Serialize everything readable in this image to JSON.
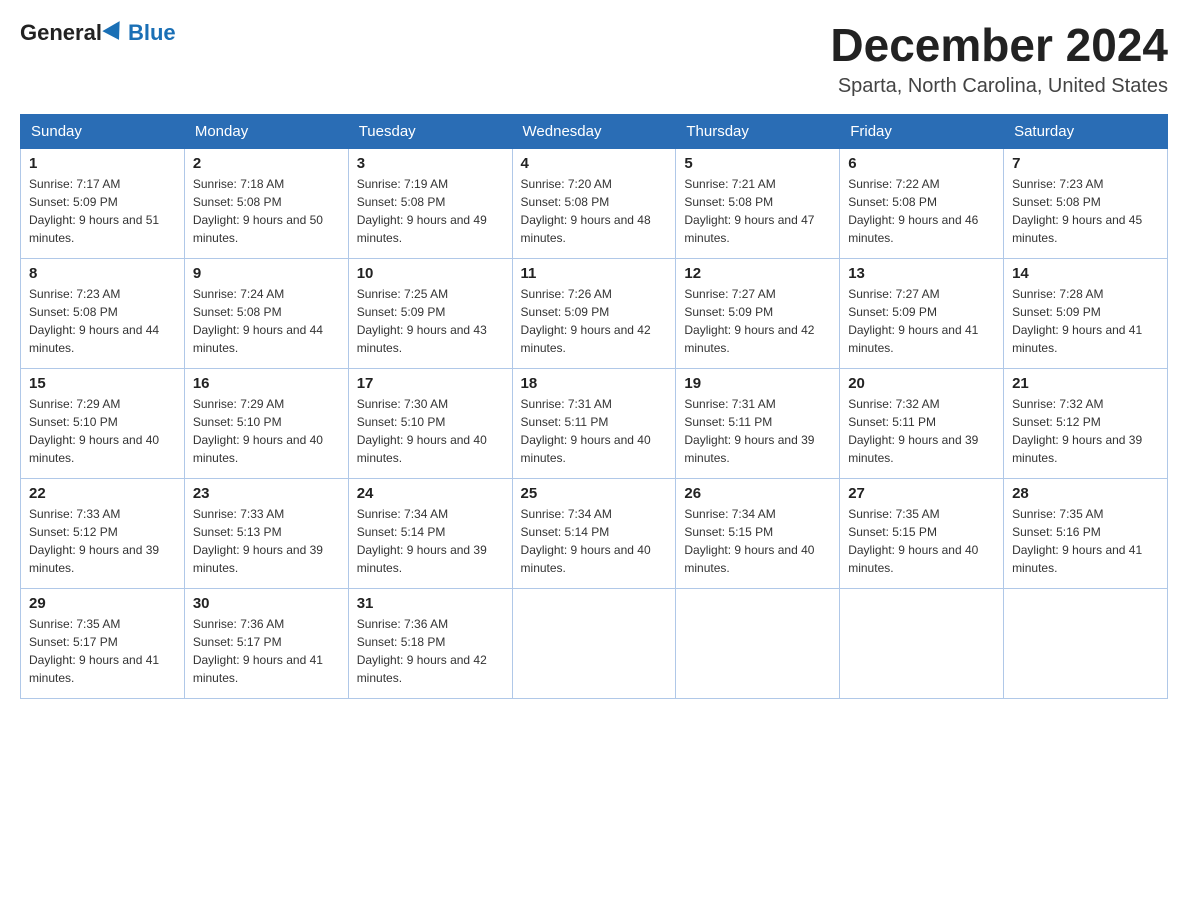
{
  "logo": {
    "general": "General",
    "blue": "Blue"
  },
  "header": {
    "month": "December 2024",
    "location": "Sparta, North Carolina, United States"
  },
  "weekdays": [
    "Sunday",
    "Monday",
    "Tuesday",
    "Wednesday",
    "Thursday",
    "Friday",
    "Saturday"
  ],
  "weeks": [
    [
      {
        "day": "1",
        "sunrise": "7:17 AM",
        "sunset": "5:09 PM",
        "daylight": "9 hours and 51 minutes."
      },
      {
        "day": "2",
        "sunrise": "7:18 AM",
        "sunset": "5:08 PM",
        "daylight": "9 hours and 50 minutes."
      },
      {
        "day": "3",
        "sunrise": "7:19 AM",
        "sunset": "5:08 PM",
        "daylight": "9 hours and 49 minutes."
      },
      {
        "day": "4",
        "sunrise": "7:20 AM",
        "sunset": "5:08 PM",
        "daylight": "9 hours and 48 minutes."
      },
      {
        "day": "5",
        "sunrise": "7:21 AM",
        "sunset": "5:08 PM",
        "daylight": "9 hours and 47 minutes."
      },
      {
        "day": "6",
        "sunrise": "7:22 AM",
        "sunset": "5:08 PM",
        "daylight": "9 hours and 46 minutes."
      },
      {
        "day": "7",
        "sunrise": "7:23 AM",
        "sunset": "5:08 PM",
        "daylight": "9 hours and 45 minutes."
      }
    ],
    [
      {
        "day": "8",
        "sunrise": "7:23 AM",
        "sunset": "5:08 PM",
        "daylight": "9 hours and 44 minutes."
      },
      {
        "day": "9",
        "sunrise": "7:24 AM",
        "sunset": "5:08 PM",
        "daylight": "9 hours and 44 minutes."
      },
      {
        "day": "10",
        "sunrise": "7:25 AM",
        "sunset": "5:09 PM",
        "daylight": "9 hours and 43 minutes."
      },
      {
        "day": "11",
        "sunrise": "7:26 AM",
        "sunset": "5:09 PM",
        "daylight": "9 hours and 42 minutes."
      },
      {
        "day": "12",
        "sunrise": "7:27 AM",
        "sunset": "5:09 PM",
        "daylight": "9 hours and 42 minutes."
      },
      {
        "day": "13",
        "sunrise": "7:27 AM",
        "sunset": "5:09 PM",
        "daylight": "9 hours and 41 minutes."
      },
      {
        "day": "14",
        "sunrise": "7:28 AM",
        "sunset": "5:09 PM",
        "daylight": "9 hours and 41 minutes."
      }
    ],
    [
      {
        "day": "15",
        "sunrise": "7:29 AM",
        "sunset": "5:10 PM",
        "daylight": "9 hours and 40 minutes."
      },
      {
        "day": "16",
        "sunrise": "7:29 AM",
        "sunset": "5:10 PM",
        "daylight": "9 hours and 40 minutes."
      },
      {
        "day": "17",
        "sunrise": "7:30 AM",
        "sunset": "5:10 PM",
        "daylight": "9 hours and 40 minutes."
      },
      {
        "day": "18",
        "sunrise": "7:31 AM",
        "sunset": "5:11 PM",
        "daylight": "9 hours and 40 minutes."
      },
      {
        "day": "19",
        "sunrise": "7:31 AM",
        "sunset": "5:11 PM",
        "daylight": "9 hours and 39 minutes."
      },
      {
        "day": "20",
        "sunrise": "7:32 AM",
        "sunset": "5:11 PM",
        "daylight": "9 hours and 39 minutes."
      },
      {
        "day": "21",
        "sunrise": "7:32 AM",
        "sunset": "5:12 PM",
        "daylight": "9 hours and 39 minutes."
      }
    ],
    [
      {
        "day": "22",
        "sunrise": "7:33 AM",
        "sunset": "5:12 PM",
        "daylight": "9 hours and 39 minutes."
      },
      {
        "day": "23",
        "sunrise": "7:33 AM",
        "sunset": "5:13 PM",
        "daylight": "9 hours and 39 minutes."
      },
      {
        "day": "24",
        "sunrise": "7:34 AM",
        "sunset": "5:14 PM",
        "daylight": "9 hours and 39 minutes."
      },
      {
        "day": "25",
        "sunrise": "7:34 AM",
        "sunset": "5:14 PM",
        "daylight": "9 hours and 40 minutes."
      },
      {
        "day": "26",
        "sunrise": "7:34 AM",
        "sunset": "5:15 PM",
        "daylight": "9 hours and 40 minutes."
      },
      {
        "day": "27",
        "sunrise": "7:35 AM",
        "sunset": "5:15 PM",
        "daylight": "9 hours and 40 minutes."
      },
      {
        "day": "28",
        "sunrise": "7:35 AM",
        "sunset": "5:16 PM",
        "daylight": "9 hours and 41 minutes."
      }
    ],
    [
      {
        "day": "29",
        "sunrise": "7:35 AM",
        "sunset": "5:17 PM",
        "daylight": "9 hours and 41 minutes."
      },
      {
        "day": "30",
        "sunrise": "7:36 AM",
        "sunset": "5:17 PM",
        "daylight": "9 hours and 41 minutes."
      },
      {
        "day": "31",
        "sunrise": "7:36 AM",
        "sunset": "5:18 PM",
        "daylight": "9 hours and 42 minutes."
      },
      null,
      null,
      null,
      null
    ]
  ],
  "labels": {
    "sunrise": "Sunrise: ",
    "sunset": "Sunset: ",
    "daylight": "Daylight: "
  }
}
